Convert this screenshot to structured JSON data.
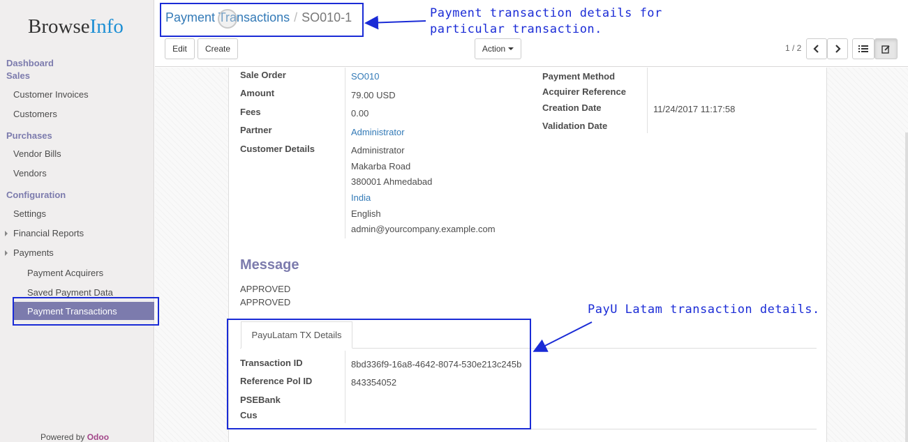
{
  "sidebar": {
    "logo_browse": "Browse",
    "logo_info": "Info",
    "dashboard": "Dashboard",
    "sales": "Sales",
    "customer_invoices": "Customer Invoices",
    "customers": "Customers",
    "purchases": "Purchases",
    "vendor_bills": "Vendor Bills",
    "vendors": "Vendors",
    "configuration": "Configuration",
    "settings": "Settings",
    "financial_reports": "Financial Reports",
    "payments": "Payments",
    "payment_acquirers": "Payment Acquirers",
    "saved_payment_data": "Saved Payment Data",
    "payment_transactions": "Payment Transactions",
    "powered_by": "Powered by ",
    "odoo": "Odoo"
  },
  "header": {
    "breadcrumb_parent": "Payment Transactions",
    "breadcrumb_sep": "/",
    "breadcrumb_current": "SO010-1",
    "edit": "Edit",
    "create": "Create",
    "action": "Action",
    "pager": "1 / 2"
  },
  "form": {
    "sale_order_label": "Sale Order",
    "sale_order": "SO010",
    "amount_label": "Amount",
    "amount": "79.00 USD",
    "fees_label": "Fees",
    "fees": "0.00",
    "partner_label": "Partner",
    "partner": "Administrator",
    "customer_details_label": "Customer Details",
    "customer_name": "Administrator",
    "street": "Makarba Road",
    "city": "380001 Ahmedabad",
    "country": "India",
    "language": "English",
    "email": "admin@yourcompany.example.com",
    "payment_method_label": "Payment Method",
    "acquirer_reference_label": "Acquirer Reference",
    "creation_date_label": "Creation Date",
    "creation_date": "11/24/2017 11:17:58",
    "validation_date_label": "Validation Date",
    "message_title": "Message",
    "message_line1": "APPROVED",
    "message_line2": "APPROVED",
    "tab_label": "PayuLatam TX Details",
    "transaction_id_label": "Transaction ID",
    "transaction_id": "8bd336f9-16a8-4642-8074-530e213c245b",
    "reference_pol_label": "Reference Pol ID",
    "reference_pol": "843354052",
    "psebank_label": "PSEBank",
    "cus_label": "Cus"
  },
  "annotations": {
    "note_top_line1": "Payment transaction details for",
    "note_top_line2": "particular transaction.",
    "note_bottom": "PayU Latam transaction details.",
    "color": "#1a2bd6"
  },
  "colors": {
    "accent": "#7c7bad",
    "link": "#337ab7",
    "odoo": "#a24689"
  }
}
